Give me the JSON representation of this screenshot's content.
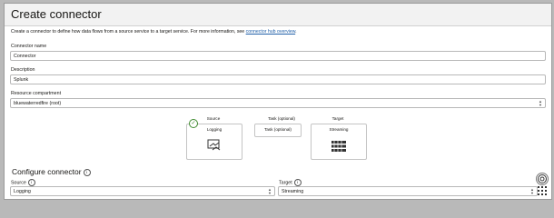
{
  "header": {
    "title": "Create connector"
  },
  "intro": {
    "text": "Create a connector to define how data flows from a source service to a target service. For more information, see",
    "link": "connector hub overview",
    "end": "."
  },
  "form": {
    "name_label": "Connector name",
    "name_value": "Connector",
    "description_label": "Description",
    "description_value": "Splunk",
    "compartment_label": "Resource compartment",
    "compartment_value": "bluewaterredfire (root)"
  },
  "flow": {
    "source": {
      "caption": "Source",
      "card": "Logging",
      "icon": "logging-icon"
    },
    "task": {
      "caption": "Task (optional)",
      "card": "Task (optional)"
    },
    "target": {
      "caption": "Target",
      "card": "Streaming",
      "icon": "streaming-icon"
    }
  },
  "configure": {
    "heading": "Configure connector",
    "source_label": "Source",
    "source_value": "Logging",
    "target_label": "Target",
    "target_value": "Streaming"
  },
  "colors": {
    "link": "#1f5fa8",
    "check": "#3f8a2f"
  }
}
